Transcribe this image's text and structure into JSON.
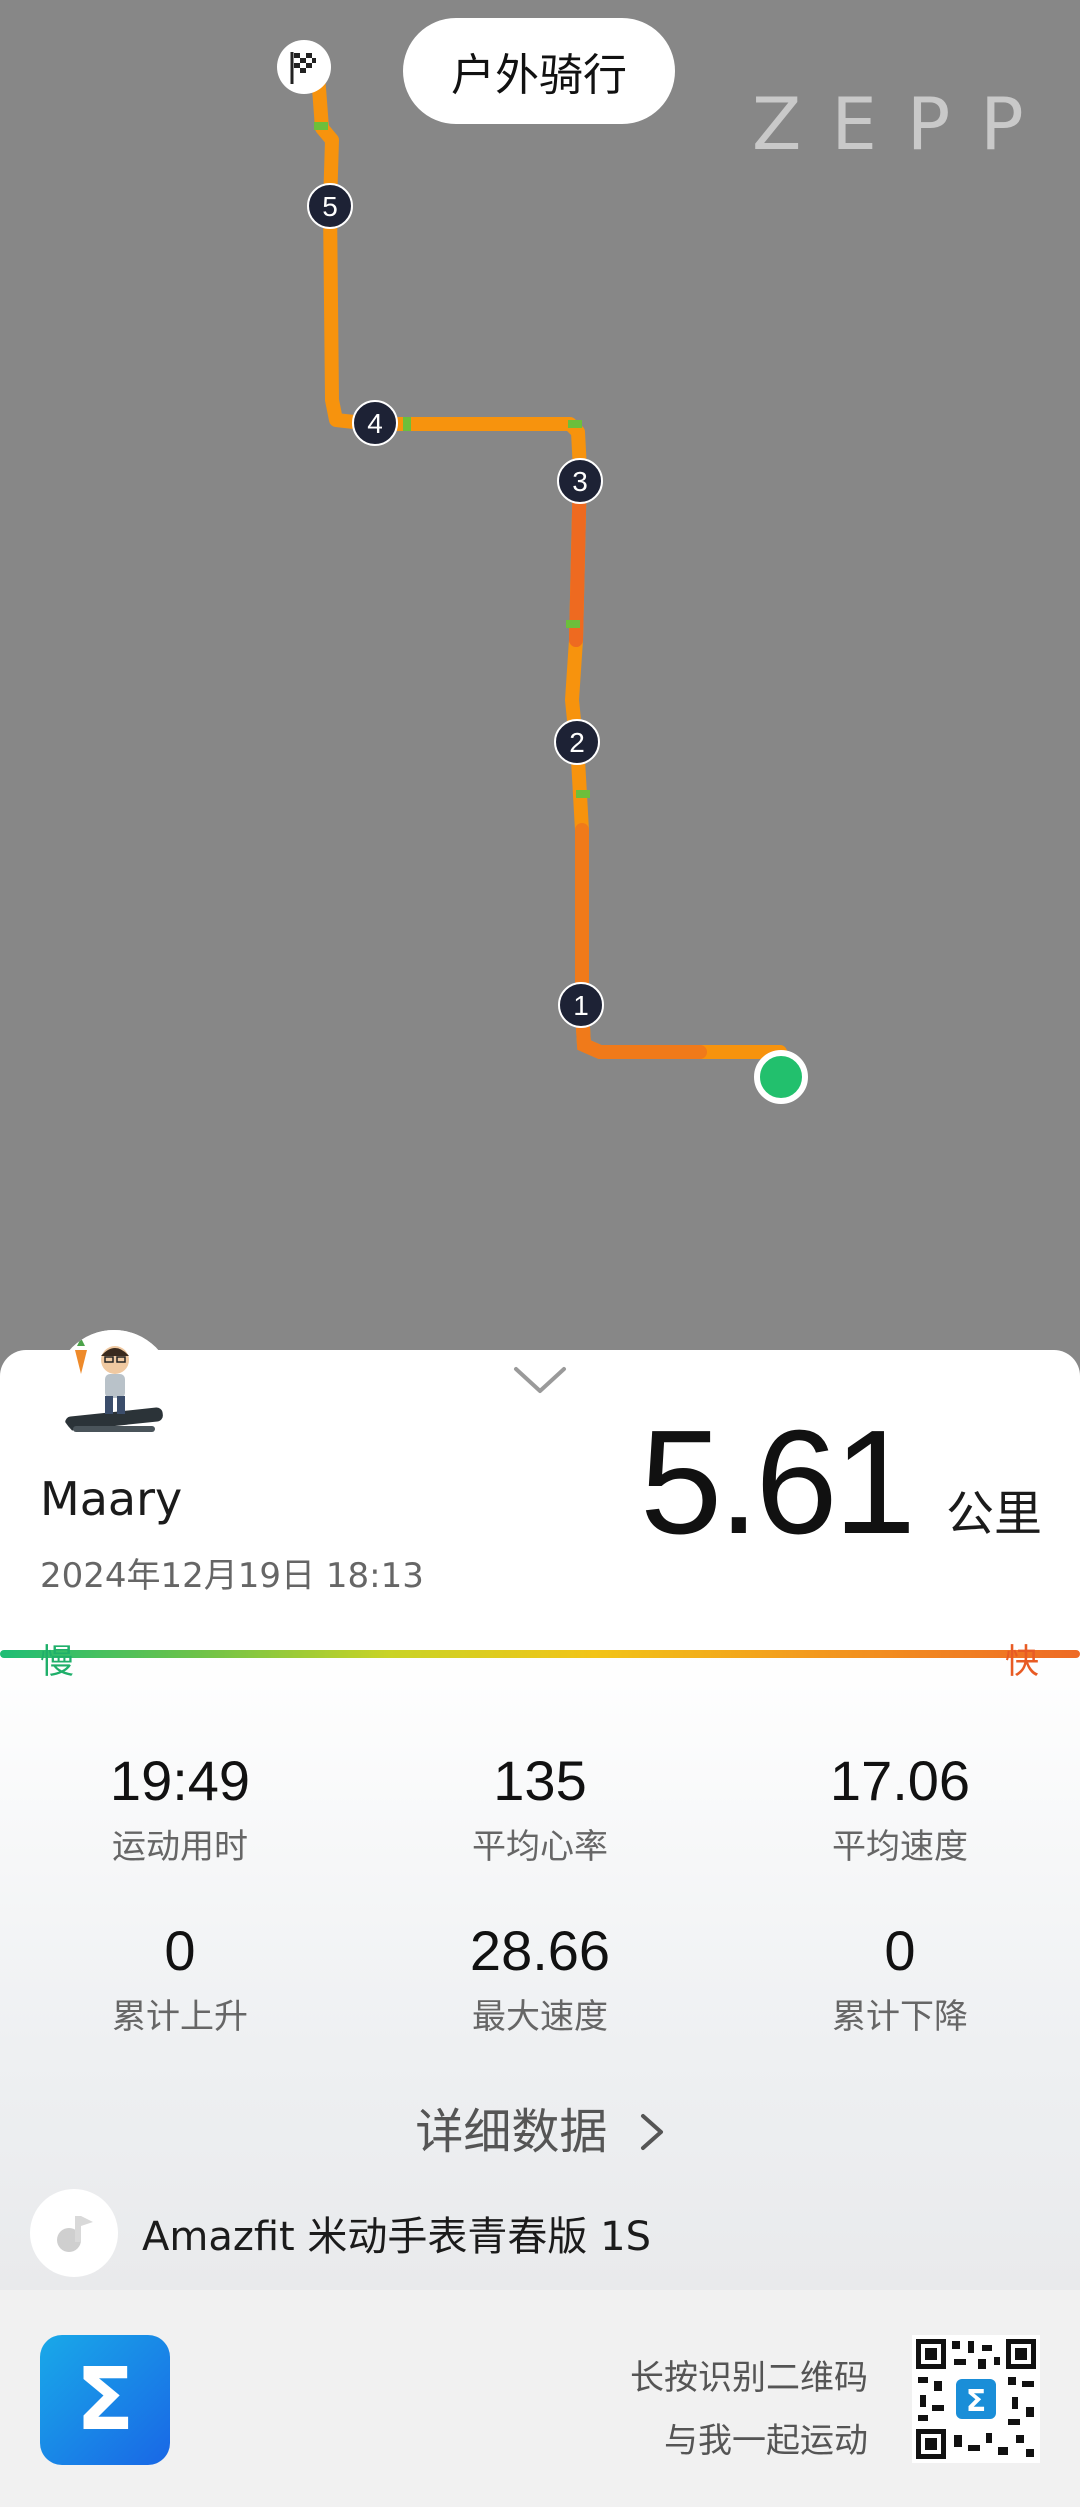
{
  "header": {
    "activity_title": "户外骑行",
    "brand": "ZEPP"
  },
  "map": {
    "route_colors": {
      "main": "#f7930d",
      "fast": "#ee6a20",
      "slow_marks": "#6cbf3b"
    },
    "start_dot_color": "#22c06d",
    "km_markers": [
      "1",
      "2",
      "3",
      "4",
      "5"
    ],
    "finish_icon": "checkered-flag-icon"
  },
  "summary": {
    "user_name": "Maary",
    "datetime": "2024年12月19日 18:13",
    "distance": "5.61",
    "distance_unit": "公里",
    "speed_scale": {
      "slow": "慢",
      "fast": "快"
    }
  },
  "stats": [
    {
      "value": "19:49",
      "label": "运动用时"
    },
    {
      "value": "135",
      "label": "平均心率"
    },
    {
      "value": "17.06",
      "label": "平均速度"
    },
    {
      "value": "0",
      "label": "累计上升"
    },
    {
      "value": "28.66",
      "label": "最大速度"
    },
    {
      "value": "0",
      "label": "累计下降"
    }
  ],
  "detail_link": {
    "label": "详细数据",
    "icon": "chevron-right-icon"
  },
  "device": {
    "name": "Amazfit 米动手表青春版 1S",
    "icon": "watch-device-icon"
  },
  "footer": {
    "app_icon": "zepp-sigma-logo-icon",
    "app_letter": "Σ",
    "qr_line1": "长按识别二维码",
    "qr_line2": "与我一起运动",
    "qr_icon": "qr-code-icon"
  }
}
